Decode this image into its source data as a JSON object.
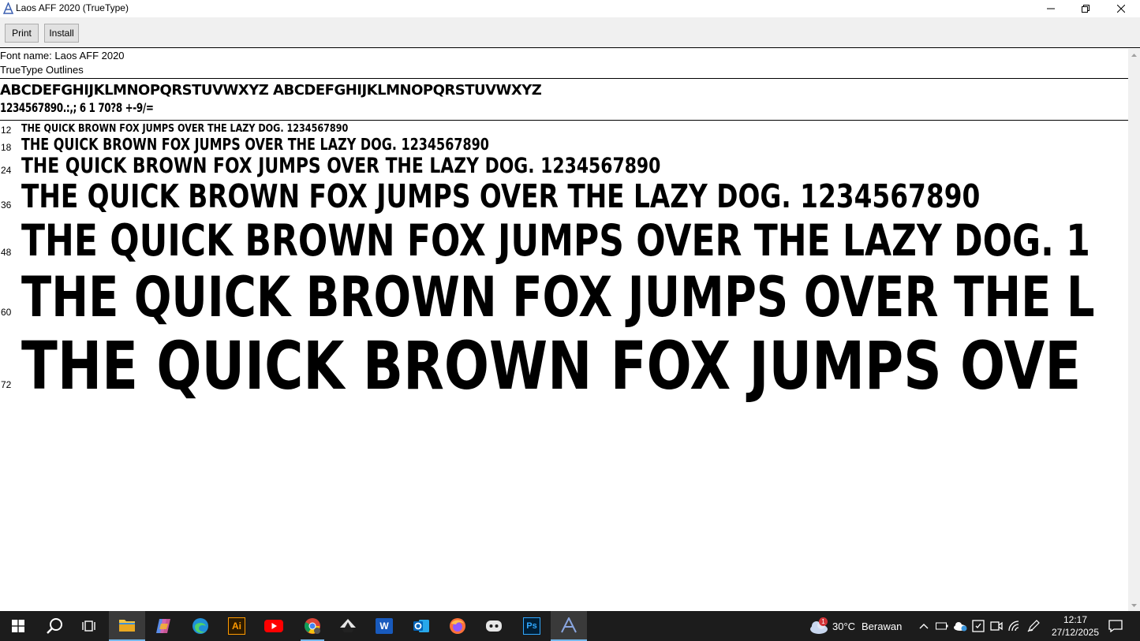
{
  "window": {
    "title": "Laos AFF 2020 (TrueType)"
  },
  "toolbar": {
    "print_label": "Print",
    "install_label": "Install"
  },
  "font_info": {
    "name_line": "Font name: Laos AFF 2020",
    "type_line": "TrueType Outlines"
  },
  "charset": {
    "letters": "ABCDEFGHIJKLMNOPQRSTUVWXYZ ABCDEFGHIJKLMNOPQRSTUVWXYZ",
    "digits": "1234567890.:,; 6 1 70?8 +-9/="
  },
  "samples": [
    {
      "size": "12",
      "text": "THE QUICK BROWN FOX JUMPS OVER THE LAZY DOG. 1234567890"
    },
    {
      "size": "18",
      "text": "THE QUICK BROWN FOX JUMPS OVER THE LAZY DOG. 1234567890"
    },
    {
      "size": "24",
      "text": "THE QUICK BROWN FOX JUMPS OVER THE LAZY DOG. 1234567890"
    },
    {
      "size": "36",
      "text": "THE QUICK BROWN FOX JUMPS OVER THE LAZY DOG. 1234567890"
    },
    {
      "size": "48",
      "text": "THE QUICK BROWN FOX JUMPS OVER THE LAZY DOG. 1"
    },
    {
      "size": "60",
      "text": "THE QUICK BROWN FOX JUMPS OVER THE L"
    },
    {
      "size": "72",
      "text": "THE QUICK BROWN FOX JUMPS OVE"
    }
  ],
  "taskbar": {
    "apps": [
      "start-icon",
      "search-icon",
      "task-view-icon",
      "file-explorer-icon",
      "copilot-icon",
      "edge-icon",
      "illustrator-icon",
      "youtube-icon",
      "chrome-icon",
      "inkscape-icon",
      "word-icon",
      "outlook-icon",
      "firefox-icon",
      "discord-icon",
      "photoshop-icon",
      "font-viewer-icon"
    ],
    "illustrator_text": "Ai",
    "word_text": "W",
    "photoshop_text": "Ps",
    "weather_badge": "1",
    "weather_temp": "30°C",
    "weather_desc": "Berawan",
    "time": "12:17",
    "date": "27/12/2025"
  },
  "colors": {
    "taskbar_bg": "#1c1c1c",
    "toolbar_bg": "#f0f0f0",
    "accent": "#76b9ed"
  }
}
